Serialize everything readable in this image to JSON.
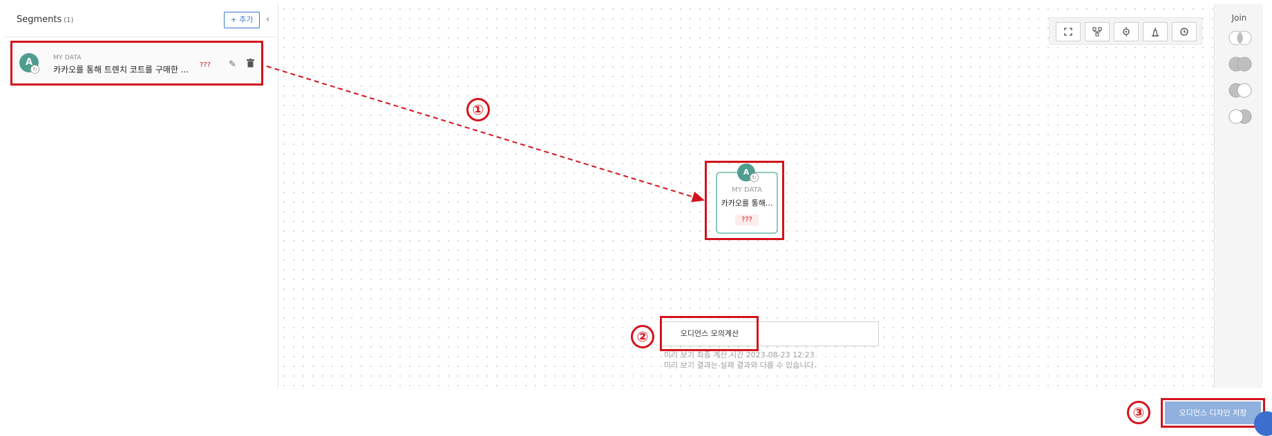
{
  "segments_panel": {
    "title": "Segments",
    "count": "(1)",
    "add_label": "+ 추가",
    "collapse_glyph": "‹",
    "items": [
      {
        "avatar": "A",
        "source": "MY DATA",
        "name": "카카오를 통해 트렌치 코트를 구매한 ...",
        "status": "???"
      }
    ]
  },
  "toolbar": {
    "icons": [
      "expand-icon",
      "hierarchy-icon",
      "center-icon",
      "person-icon",
      "history-icon"
    ],
    "glyphs": [
      "⛶",
      "⊞",
      "⌖",
      "⍋",
      "⟲"
    ]
  },
  "node": {
    "avatar": "A",
    "source": "MY DATA",
    "name": "카카오를 통해...",
    "status": "???"
  },
  "simulation": {
    "button_label": "오디언스 모의계산",
    "info_line1": "미리 보기 최종 계산 시간 2023-08-23 12:23",
    "info_line2": "미리 보기 결과는 실제 결과와 다를 수 있습니다."
  },
  "join_panel": {
    "title": "Join",
    "icons": [
      "intersect-join-icon",
      "full-join-icon",
      "left-join-icon",
      "right-join-icon"
    ]
  },
  "save": {
    "label": "오디언스 디자인 저장"
  },
  "steps": [
    "①",
    "②",
    "③"
  ],
  "colors": {
    "annotation": "#d3121b",
    "accent": "#3a78c9",
    "avatar": "#4f9d8e",
    "save_button": "#90b1de"
  }
}
